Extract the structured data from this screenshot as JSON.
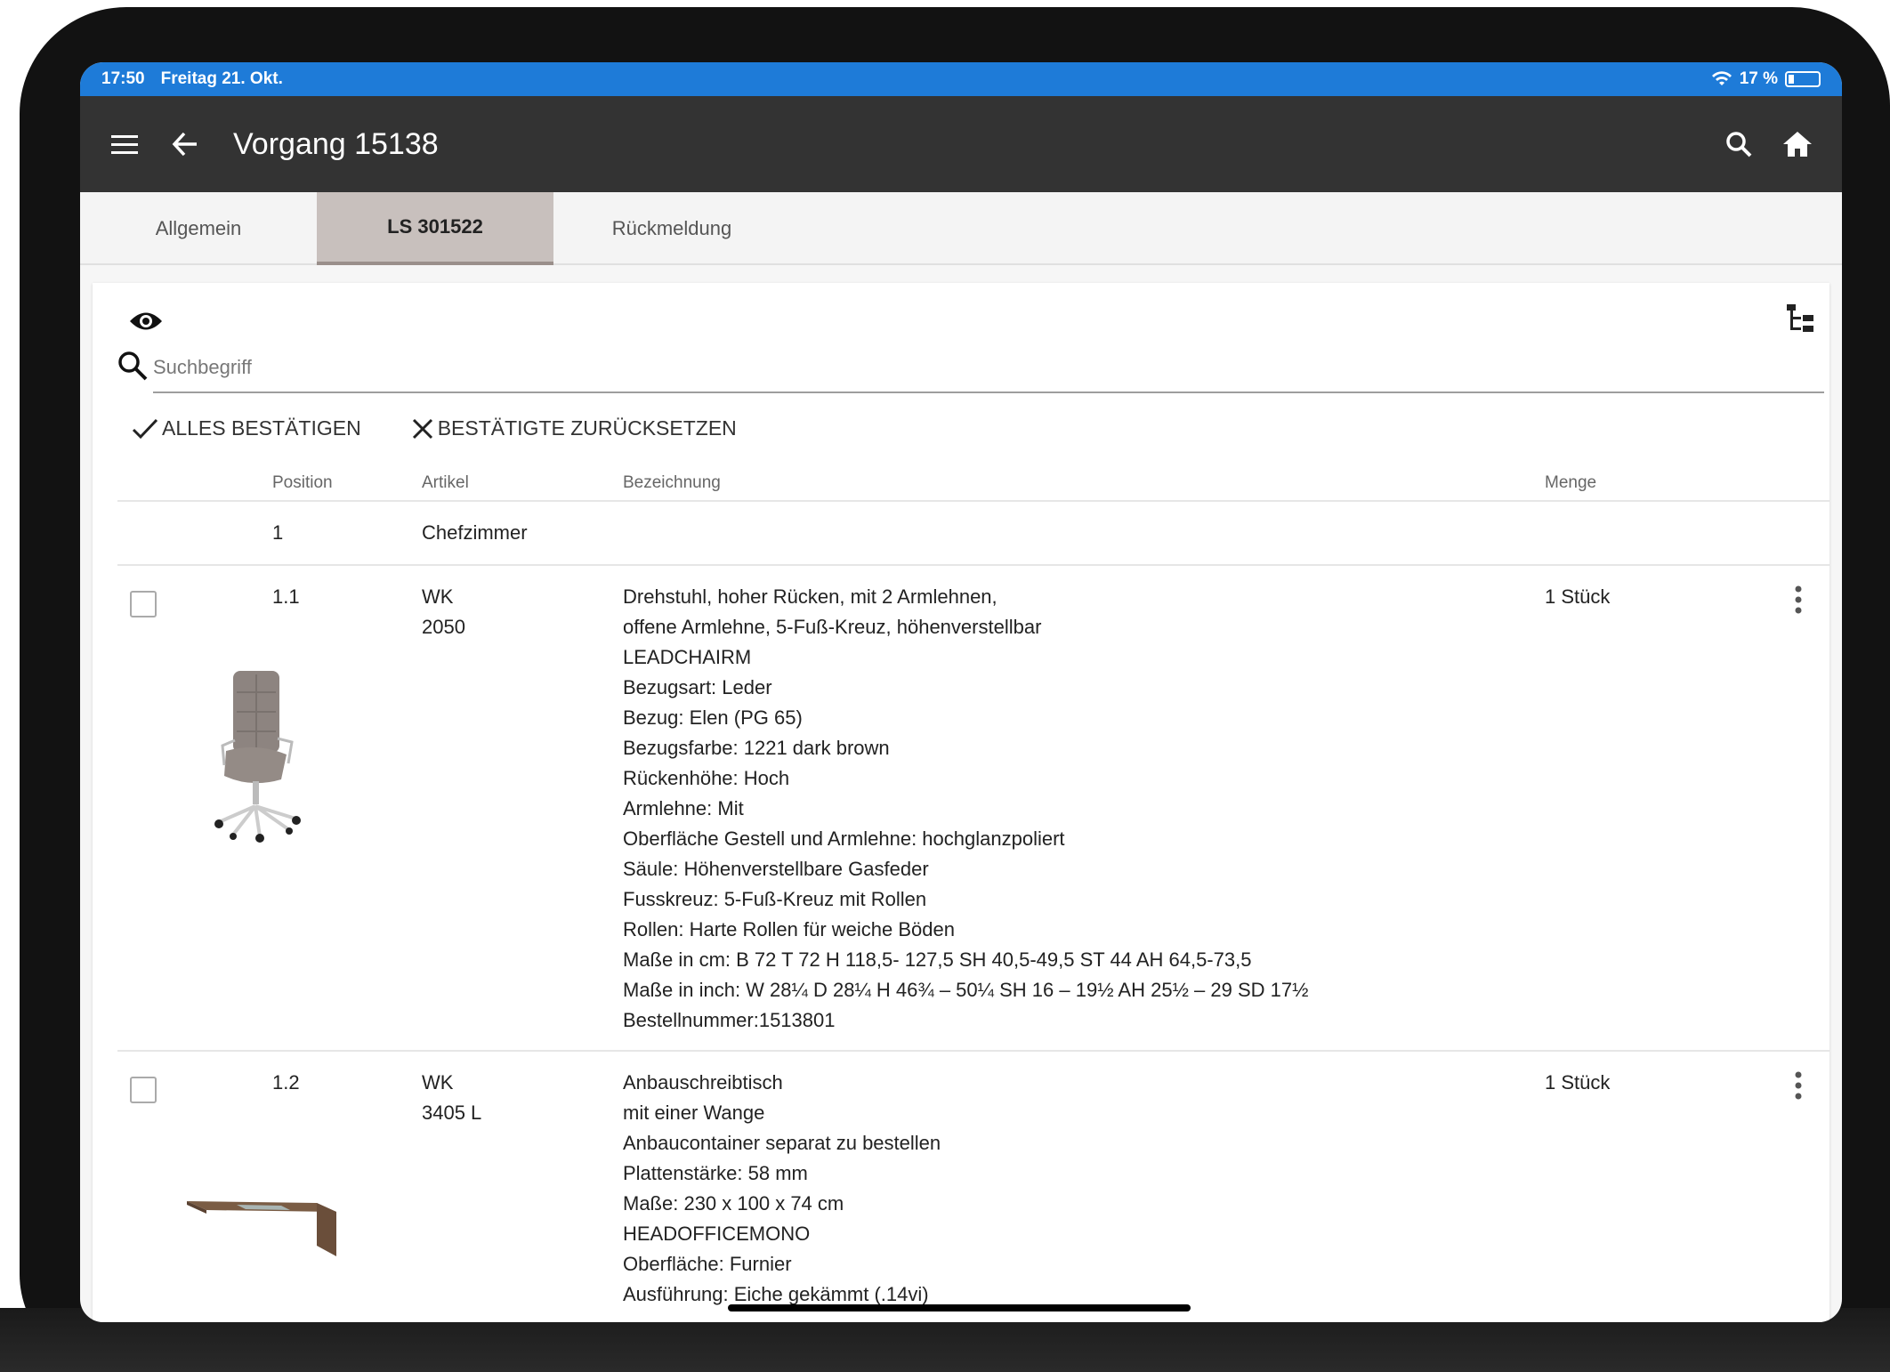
{
  "status": {
    "time": "17:50",
    "date": "Freitag 21. Okt.",
    "battery": "17 %"
  },
  "appbar": {
    "title": "Vorgang 15138"
  },
  "tabs": [
    {
      "label": "Allgemein"
    },
    {
      "label": "LS 301522"
    },
    {
      "label": "Rückmeldung"
    }
  ],
  "search": {
    "placeholder": "Suchbegriff"
  },
  "actions": {
    "confirm_all": "ALLES BESTÄTIGEN",
    "reset_confirmed": "BESTÄTIGTE ZURÜCKSETZEN"
  },
  "table": {
    "headers": {
      "position": "Position",
      "artikel": "Artikel",
      "bezeichnung": "Bezeichnung",
      "menge": "Menge"
    },
    "group": {
      "position": "1",
      "name": "Chefzimmer"
    },
    "rows": [
      {
        "position": "1.1",
        "artikel_1": "WK",
        "artikel_2": "2050",
        "menge": "1 Stück",
        "lines": [
          "Drehstuhl, hoher Rücken, mit 2 Armlehnen,",
          "offene Armlehne, 5-Fuß-Kreuz, höhenverstellbar",
          "LEADCHAIRM",
          "Bezugsart: Leder",
          "Bezug: Elen (PG 65)",
          "Bezugsfarbe: 1221 dark brown",
          "Rückenhöhe: Hoch",
          "Armlehne: Mit",
          "Oberfläche Gestell und Armlehne: hochglanzpoliert",
          "Säule: Höhenverstellbare Gasfeder",
          "Fusskreuz: 5-Fuß-Kreuz mit Rollen",
          "Rollen: Harte Rollen für weiche Böden",
          "Maße in cm: B 72 T 72 H 118,5- 127,5 SH 40,5-49,5 ST 44 AH 64,5-73,5",
          "Maße in inch: W 28¼ D 28¼ H 46¾ – 50¼ SH 16 – 19½ AH 25½ – 29 SD 17½",
          "Bestellnummer:1513801"
        ]
      },
      {
        "position": "1.2",
        "artikel_1": "WK",
        "artikel_2": "3405 L",
        "menge": "1 Stück",
        "lines": [
          "Anbauschreibtisch",
          "mit einer Wange",
          "Anbaucontainer separat zu bestellen",
          "Plattenstärke: 58 mm",
          "Maße: 230 x 100 x 74 cm",
          "HEADOFFICEMONO",
          "Oberfläche: Furnier",
          "Ausführung: Eiche gekämmt (.14vi)"
        ]
      }
    ]
  },
  "colors": {
    "status_bar": "#1e7bd8",
    "app_bar": "#333333",
    "active_tab": "#c8c0bd"
  }
}
